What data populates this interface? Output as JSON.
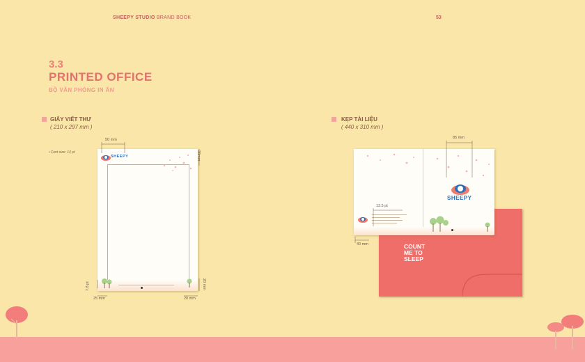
{
  "header": {
    "brand": "SHEEPY STUDIO",
    "book": "BRAND BOOK",
    "page_number": "53"
  },
  "section": {
    "number": "3.3",
    "title": "PRINTED OFFICE",
    "subtitle": "BỘ VĂN PHÒNG IN ẤN"
  },
  "letterhead": {
    "title": "GIẤY VIẾT THƯ",
    "size": "( 210 x 297 mm )",
    "note": "• Font size: 14 pt",
    "logo_text": "SHEEPY",
    "dims": {
      "top_logo": "50 mm",
      "top_right": "30mm",
      "bottom_left_pt": "7.8 pt",
      "bottom_right": "20 mm",
      "left_bottom": "25 mm",
      "right_bottom": "20 mm"
    }
  },
  "folder": {
    "title": "KẸP TÀI LIỆU",
    "size": "( 440 x 310 mm )",
    "logo_text": "SHEEPY",
    "back_text": [
      "COUNT",
      "ME TO",
      "SLEEP"
    ],
    "dims": {
      "top": "85 mm",
      "contact": "13.5 pt",
      "left": "40 mm"
    }
  },
  "colors": {
    "background": "#f9e6a8",
    "accent": "#e4716d",
    "folder_back": "#ef6e69",
    "ground": "#f7a09c",
    "logo_blue": "#2f6fb8"
  }
}
